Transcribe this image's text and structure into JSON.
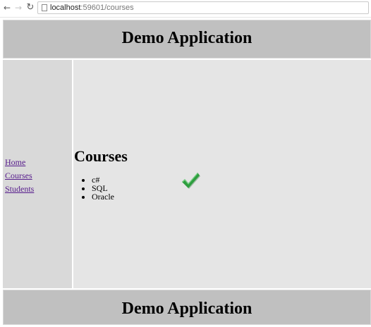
{
  "browser": {
    "back_icon": "back-arrow-icon",
    "forward_icon": "forward-arrow-icon",
    "reload_icon": "reload-icon",
    "url_host": "localhost",
    "url_rest": ":59601/courses"
  },
  "header": {
    "title": "Demo Application"
  },
  "sidebar": {
    "items": [
      {
        "label": "Home"
      },
      {
        "label": "Courses"
      },
      {
        "label": "Students"
      }
    ]
  },
  "main": {
    "heading": "Courses",
    "courses": [
      "c#",
      "SQL",
      "Oracle"
    ],
    "check_icon": "checkmark-icon",
    "check_color": "#2e9e3f"
  },
  "footer": {
    "title": "Demo Application"
  },
  "colors": {
    "header_bg": "#c0c0c0",
    "sidebar_bg": "#d9d9d9",
    "content_bg": "#e5e5e5",
    "link": "#551a8b"
  }
}
